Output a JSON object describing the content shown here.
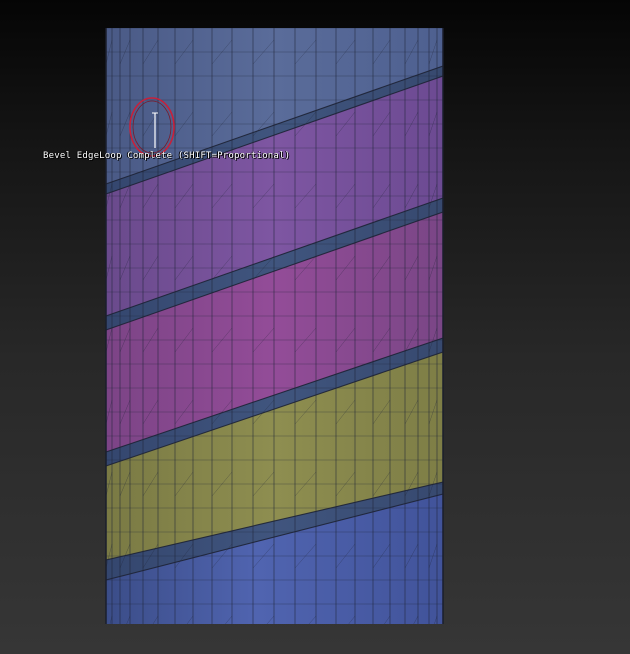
{
  "viewport": {
    "tooltip": "Bevel EdgeLoop Complete (SHIFT=Proportional)",
    "cursor_icon": "brush-circle-cursor",
    "colors": {
      "blue_polygroup": "#4d60a8",
      "purple_polygroup": "#76509a",
      "magenta_polygroup": "#8a4a90",
      "olive_polygroup": "#8a8a4c",
      "bevel_edge": "#3b4f78",
      "cursor_ring": "#c8203a",
      "wire": "#1e2436"
    }
  }
}
